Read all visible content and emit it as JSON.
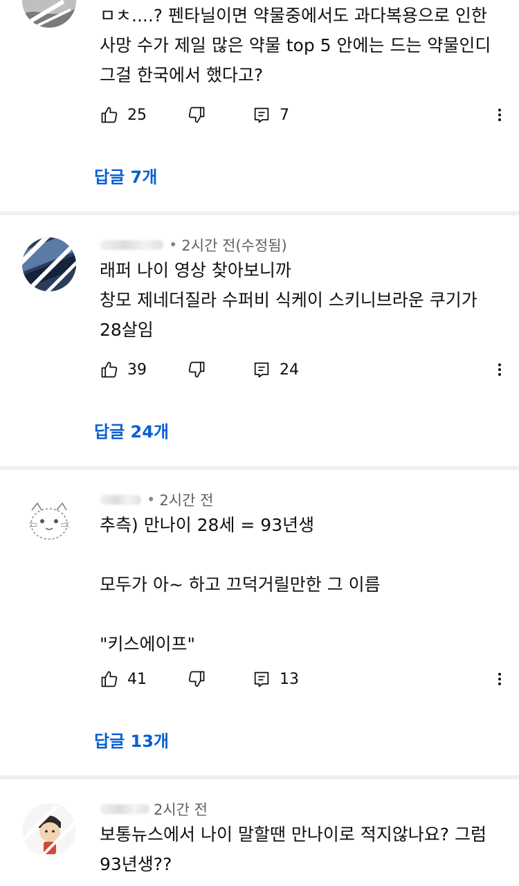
{
  "comments": [
    {
      "time": "",
      "lines": [
        "ㅁㅊ....? 펜타닐이면 약물중에서도 과다복용으로 인한",
        "사망 수가 제일 많은 약물 top 5 안에는 드는 약물인디",
        "그걸 한국에서 했다고?"
      ],
      "likes": "25",
      "reply_count": "7",
      "replies_label": "답글 7개"
    },
    {
      "time": "2시간 전(수정됨)",
      "lines": [
        "래퍼 나이 영상 찾아보니까",
        "창모 제네더질라 수퍼비 식케이 스키니브라운 쿠기가",
        "28살임"
      ],
      "likes": "39",
      "reply_count": "24",
      "replies_label": "답글 24개"
    },
    {
      "time": "2시간 전",
      "lines": [
        "추측) 만나이 28세 = 93년생",
        "",
        "모두가 아~ 하고 끄덕거릴만한 그 이름",
        "",
        "\"키스에이프\""
      ],
      "likes": "41",
      "reply_count": "13",
      "replies_label": "답글 13개"
    },
    {
      "time": "2시간 전",
      "lines": [
        "보통뉴스에서 나이 말할땐 만나이로 적지않나요? 그럼",
        "93년생??"
      ]
    }
  ],
  "icons": {
    "like": "thumbs-up-icon",
    "dislike": "thumbs-down-icon",
    "reply": "comment-icon",
    "more": "more-vert-icon"
  },
  "colors": {
    "link": "#065fd4",
    "meta": "#606060",
    "divider": "#f0f0f0"
  }
}
